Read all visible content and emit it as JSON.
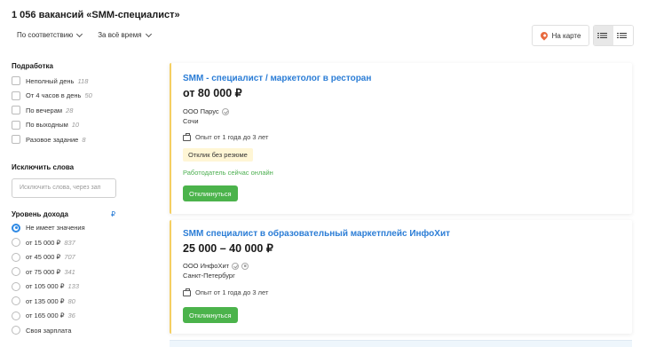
{
  "header": {
    "title": "1 056 вакансий «SMM-специалист»",
    "sort": "По соответствию",
    "period": "За всё время",
    "map_label": "На карте"
  },
  "icons": {
    "map": "map-pin-icon",
    "list": "list-view-icon",
    "compact": "compact-list-icon"
  },
  "sidebar": {
    "parttime_title": "Подработка",
    "parttime": [
      {
        "label": "Неполный день",
        "count": "118"
      },
      {
        "label": "От 4 часов в день",
        "count": "50"
      },
      {
        "label": "По вечерам",
        "count": "28"
      },
      {
        "label": "По выходным",
        "count": "10"
      },
      {
        "label": "Разовое задание",
        "count": "8"
      }
    ],
    "exclude_title": "Исключить слова",
    "exclude_placeholder": "Исключить слова, через зап",
    "income_title": "Уровень дохода",
    "currency": "₽",
    "income": [
      {
        "label": "Не имеет значения",
        "count": "",
        "selected": true
      },
      {
        "label": "от 15 000 ₽",
        "count": "837"
      },
      {
        "label": "от 45 000 ₽",
        "count": "707"
      },
      {
        "label": "от 75 000 ₽",
        "count": "341"
      },
      {
        "label": "от 105 000 ₽",
        "count": "133"
      },
      {
        "label": "от 135 000 ₽",
        "count": "80"
      },
      {
        "label": "от 165 000 ₽",
        "count": "36"
      },
      {
        "label": "Своя зарплата",
        "count": ""
      }
    ]
  },
  "vacancies": [
    {
      "title": "SMM - специалист / маркетолог в ресторан",
      "salary": "от 80 000 ₽",
      "company": "ООО Парус",
      "city": "Сочи",
      "experience": "Опыт от 1 года до 3 лет",
      "badge": "Отклик без резюме",
      "online": "Работодатель сейчас онлайн",
      "button": "Откликнуться"
    },
    {
      "title": "SMM специалист в образовательный маркетплейс ИнфоХит",
      "salary": "25 000 – 40 000 ₽",
      "company": "ООО ИнфоХит",
      "city": "Санкт-Петербург",
      "experience": "Опыт от 1 года до 3 лет",
      "button": "Откликнуться"
    }
  ],
  "colors": {
    "accent": "#2b7dd6",
    "apply_button": "#4bb34b",
    "card_border": "#f5cf62",
    "online": "#4caf50"
  }
}
